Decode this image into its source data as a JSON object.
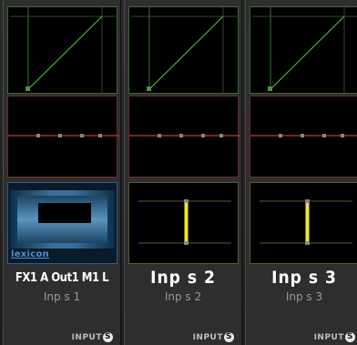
{
  "strips": [
    {
      "name": "FX1 A Out1 M1 L",
      "sub": "Inp s 1",
      "tag": "INPUT",
      "tag_btn": "S",
      "has_fx": true,
      "fx_brand": "lexicon"
    },
    {
      "name": "Inp s  2",
      "sub": "Inp s  2",
      "tag": "INPUT",
      "tag_btn": "S",
      "has_fx": false
    },
    {
      "name": "Inp s  3",
      "sub": "Inp s  3",
      "tag": "INPUT",
      "tag_btn": "S",
      "has_fx": false
    }
  ],
  "colors": {
    "dyn_line": "#5cc24a",
    "eq_line": "#c43a3a",
    "level_bar": "#f2e52a",
    "fx_brand": "#4f8fd6"
  }
}
